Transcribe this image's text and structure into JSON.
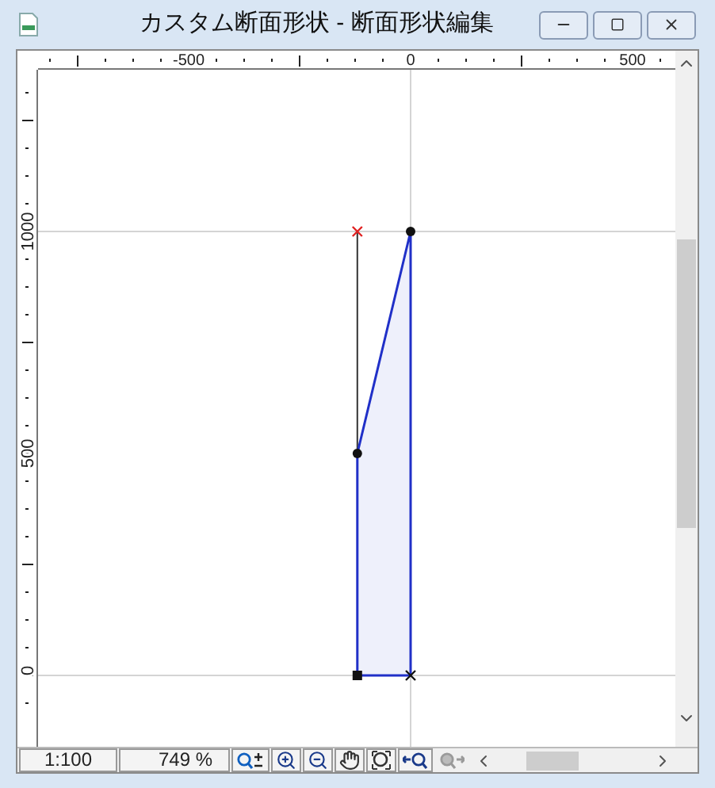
{
  "window": {
    "title": "カスタム断面形状 - 断面形状編集"
  },
  "ruler_top": {
    "labels": [
      "-500",
      "0",
      "500"
    ]
  },
  "ruler_left": {
    "labels": [
      "1000",
      "500",
      "0"
    ]
  },
  "status_bar": {
    "scale": "1:100",
    "zoom": "749 %",
    "tools": [
      {
        "kind": "zoom-toggle",
        "disabled": false
      },
      {
        "kind": "zoom-in",
        "disabled": false
      },
      {
        "kind": "zoom-out",
        "disabled": false
      },
      {
        "kind": "pan",
        "disabled": false
      },
      {
        "kind": "zoom-fit",
        "disabled": false
      },
      {
        "kind": "back",
        "disabled": false
      },
      {
        "kind": "forward",
        "disabled": true
      }
    ]
  }
}
